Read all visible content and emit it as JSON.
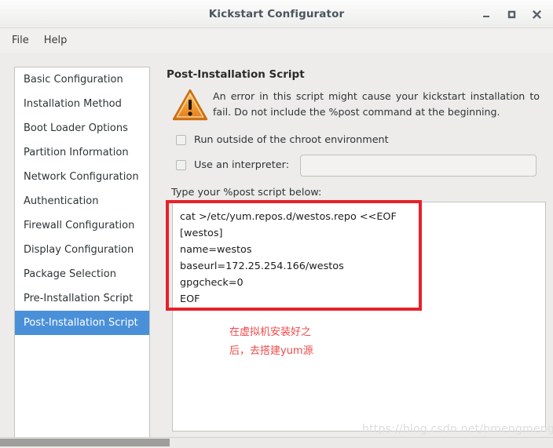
{
  "window": {
    "title": "Kickstart Configurator",
    "buttons": {
      "minimize": "minimize-button",
      "maximize": "maximize-button",
      "close": "close-button"
    }
  },
  "menubar": {
    "items": [
      {
        "label": "File"
      },
      {
        "label": "Help"
      }
    ]
  },
  "sidebar": {
    "items": [
      {
        "label": "Basic Configuration",
        "selected": false
      },
      {
        "label": "Installation Method",
        "selected": false
      },
      {
        "label": "Boot Loader Options",
        "selected": false
      },
      {
        "label": "Partition Information",
        "selected": false
      },
      {
        "label": "Network Configuration",
        "selected": false
      },
      {
        "label": "Authentication",
        "selected": false
      },
      {
        "label": "Firewall Configuration",
        "selected": false
      },
      {
        "label": "Display Configuration",
        "selected": false
      },
      {
        "label": "Package Selection",
        "selected": false
      },
      {
        "label": "Pre-Installation Script",
        "selected": false
      },
      {
        "label": "Post-Installation Script",
        "selected": true
      }
    ],
    "selected_label": "Post-Installation Script",
    "selection_color": "#4a90d9"
  },
  "panel": {
    "title": "Post-Installation Script",
    "warning": {
      "icon": "warning-triangle-icon",
      "color": "#f0932b",
      "text": "An error in this script might cause your kickstart installation to fail. Do not include the %post command at the beginning."
    },
    "checkbox_chroot": {
      "label": "Run outside of the chroot environment",
      "checked": false
    },
    "checkbox_interpreter": {
      "label": "Use an interpreter:",
      "checked": false
    },
    "interpreter_input": {
      "value": "",
      "placeholder": "",
      "enabled": false
    },
    "script_label": "Type your %post script below:",
    "script_value": "cat >/etc/yum.repos.d/westos.repo <<EOF\n[westos]\nname=westos\nbaseurl=172.25.254.166/westos\ngpgcheck=0\nEOF"
  },
  "annotations": {
    "red_box_color": "#e8202a",
    "note_color": "#f04a4a",
    "note_text": "在虚拟机安装好之\n后，去搭建yum源"
  },
  "watermark": {
    "text": "https://blog.csdn.net/bmengmeng"
  }
}
